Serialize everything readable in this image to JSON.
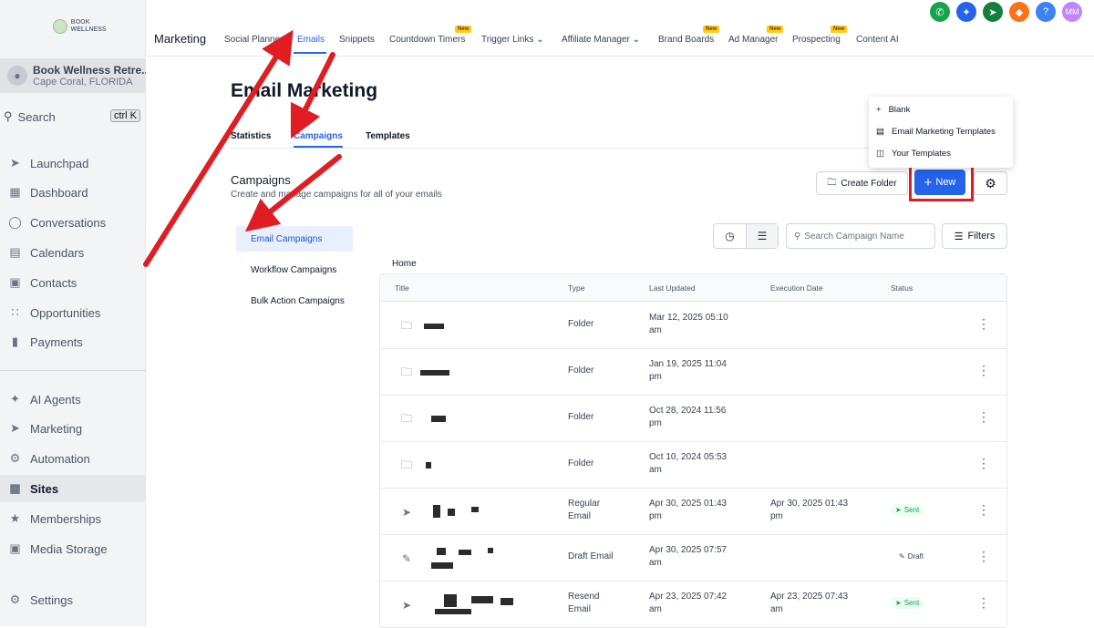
{
  "sidebar": {
    "logo_text": "BOOK WELLNESS",
    "location_name": "Book Wellness Retre...",
    "location_sub": "Cape Coral, FLORIDA",
    "search_label": "Search",
    "search_shortcut": "ctrl K",
    "items": [
      {
        "label": "Launchpad",
        "icon": "rocket-icon"
      },
      {
        "label": "Dashboard",
        "icon": "dashboard-icon"
      },
      {
        "label": "Conversations",
        "icon": "chat-icon"
      },
      {
        "label": "Calendars",
        "icon": "calendar-icon"
      },
      {
        "label": "Contacts",
        "icon": "contacts-icon"
      },
      {
        "label": "Opportunities",
        "icon": "opportunities-icon"
      },
      {
        "label": "Payments",
        "icon": "payments-icon"
      },
      {
        "label": "AI Agents",
        "icon": "sparkle-icon"
      },
      {
        "label": "Marketing",
        "icon": "send-icon"
      },
      {
        "label": "Automation",
        "icon": "automation-icon"
      },
      {
        "label": "Sites",
        "icon": "sites-icon"
      },
      {
        "label": "Memberships",
        "icon": "memberships-icon"
      },
      {
        "label": "Media Storage",
        "icon": "media-icon"
      },
      {
        "label": "Settings",
        "icon": "gear-icon"
      }
    ]
  },
  "topbar": {
    "brand": "Marketing",
    "nav": [
      {
        "label": "Social Planner",
        "badge": ""
      },
      {
        "label": "Emails",
        "badge": ""
      },
      {
        "label": "Snippets",
        "badge": ""
      },
      {
        "label": "Countdown Timers",
        "badge": "New"
      },
      {
        "label": "Trigger Links",
        "badge": ""
      },
      {
        "label": "Affiliate Manager",
        "badge": ""
      },
      {
        "label": "Brand Boards",
        "badge": "New"
      },
      {
        "label": "Ad Manager",
        "badge": "New"
      },
      {
        "label": "Prospecting",
        "badge": "New"
      },
      {
        "label": "Content AI",
        "badge": ""
      }
    ],
    "user_initials": "MM"
  },
  "page": {
    "title": "Email Marketing",
    "tabs": [
      "Statistics",
      "Campaigns",
      "Templates"
    ],
    "section_title": "Campaigns",
    "section_sub": "Create and manage campaigns for all of your emails",
    "create_folder_label": "Create Folder",
    "new_label": "New",
    "search_placeholder": "Search Campaign Name",
    "filters_label": "Filters",
    "breadcrumb": "Home"
  },
  "new_menu": [
    "Blank",
    "Email Marketing Templates",
    "Your Templates"
  ],
  "campaign_types": [
    "Email Campaigns",
    "Workflow Campaigns",
    "Bulk Action Campaigns"
  ],
  "table": {
    "headers": [
      "Title",
      "Type",
      "Last Updated",
      "Execution Date",
      "Status"
    ],
    "rows": [
      {
        "icon": "folder-icon",
        "type": "Folder",
        "type2": "",
        "updated": "Mar 12, 2025 05:10",
        "updated2": "am",
        "exec": "",
        "exec2": "",
        "status": ""
      },
      {
        "icon": "folder-icon",
        "type": "Folder",
        "type2": "",
        "updated": "Jan 19, 2025 11:04",
        "updated2": "pm",
        "exec": "",
        "exec2": "",
        "status": ""
      },
      {
        "icon": "folder-icon",
        "type": "Folder",
        "type2": "",
        "updated": "Oct 28, 2024 11:56",
        "updated2": "pm",
        "exec": "",
        "exec2": "",
        "status": ""
      },
      {
        "icon": "folder-icon",
        "type": "Folder",
        "type2": "",
        "updated": "Oct 10, 2024 05:53",
        "updated2": "am",
        "exec": "",
        "exec2": "",
        "status": ""
      },
      {
        "icon": "send-icon",
        "type": "Regular",
        "type2": "Email",
        "updated": "Apr 30, 2025 01:43",
        "updated2": "pm",
        "exec": "Apr 30, 2025 01:43",
        "exec2": "pm",
        "status": "Sent"
      },
      {
        "icon": "edit-icon",
        "type": "Draft Email",
        "type2": "",
        "updated": "Apr 30, 2025 07:57",
        "updated2": "am",
        "exec": "",
        "exec2": "",
        "status": "Draft"
      },
      {
        "icon": "resend-icon",
        "type": "Resend",
        "type2": "Email",
        "updated": "Apr 23, 2025 07:42",
        "updated2": "am",
        "exec": "Apr 23, 2025 07:43",
        "exec2": "am",
        "status": "Sent"
      }
    ]
  },
  "colors": {
    "accent": "#2563eb",
    "annotation_red": "#e11d24",
    "sent": "#16a34a"
  }
}
